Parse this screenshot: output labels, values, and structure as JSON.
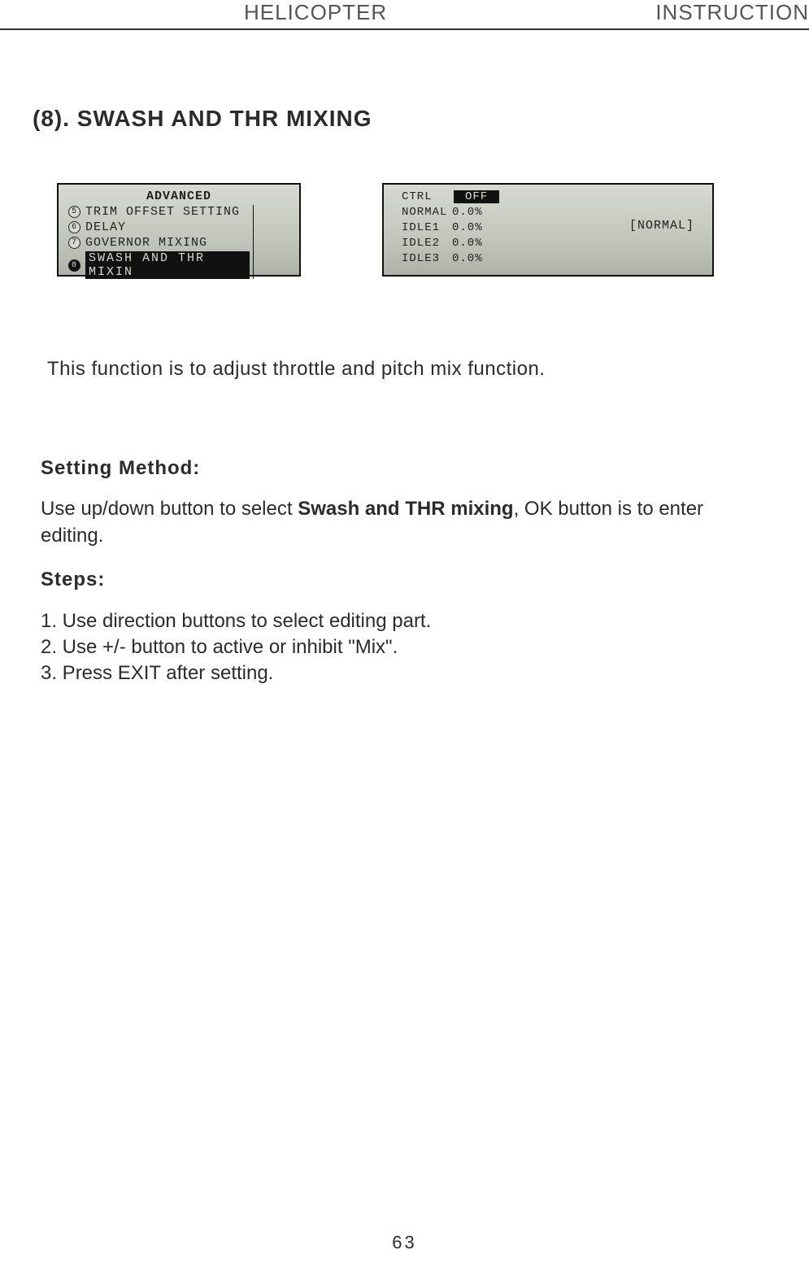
{
  "header": {
    "left": "HELICOPTER",
    "right": "INSTRUCTION"
  },
  "section_title": "(8). SWASH AND THR MIXING",
  "lcd_menu": {
    "title": "ADVANCED",
    "items": [
      {
        "num": "5",
        "label": "TRIM OFFSET SETTING",
        "selected": false
      },
      {
        "num": "6",
        "label": "DELAY",
        "selected": false
      },
      {
        "num": "7",
        "label": "GOVERNOR MIXING",
        "selected": false
      },
      {
        "num": "8",
        "label": "SWASH AND THR MIXIN",
        "selected": true
      }
    ]
  },
  "lcd_values": {
    "rows": [
      {
        "label": "CTRL",
        "value": "OFF",
        "pill": true
      },
      {
        "label": "NORMAL",
        "value": "0.0%"
      },
      {
        "label": "IDLE1",
        "value": "0.0%"
      },
      {
        "label": "IDLE2",
        "value": "0.0%"
      },
      {
        "label": "IDLE3",
        "value": "0.0%"
      }
    ],
    "mode": "[NORMAL]"
  },
  "intro": "This function is to adjust throttle and pitch mix function.",
  "setting_method": {
    "heading": "Setting Method:",
    "text_pre": "Use up/down button to select ",
    "text_strong": "Swash and THR mixing",
    "text_post": ", OK button is to enter editing."
  },
  "steps": {
    "heading": "Steps:",
    "items": [
      "1. Use direction buttons to select editing part.",
      "2. Use +/- button to active or inhibit \"Mix\".",
      "3. Press EXIT after setting."
    ]
  },
  "page_number": "63"
}
